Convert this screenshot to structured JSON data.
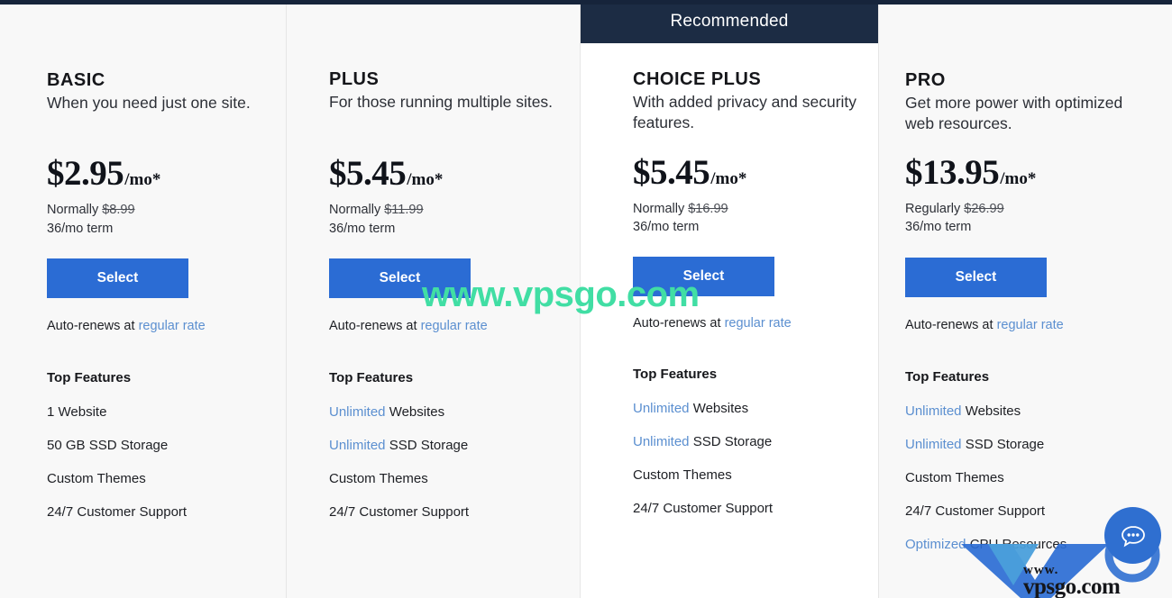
{
  "top_strip_color": "#16243b",
  "accent": {
    "button_blue": "#2b6cd4",
    "link_blue": "#5b8fd0",
    "banner_navy": "#1c2c44",
    "watermark_green": "#41dea4",
    "chat_blue": "#2f6fd0"
  },
  "recommended_banner": {
    "label": "Recommended",
    "applies_to": "CHOICE PLUS"
  },
  "plans": [
    {
      "id": "basic",
      "name": "BASIC",
      "tagline": "When you need just one site.",
      "price": "$2.95",
      "price_suffix": "/mo*",
      "compare_label": "Normally",
      "compare_price": "$8.99",
      "term": "36/mo term",
      "cta": "Select",
      "renew_prefix": "Auto-renews at",
      "renew_link": "regular rate",
      "features_title": "Top Features",
      "features": [
        {
          "highlight": "",
          "text": "1 Website"
        },
        {
          "highlight": "",
          "text": "50 GB SSD Storage"
        },
        {
          "highlight": "",
          "text": "Custom Themes"
        },
        {
          "highlight": "",
          "text": "24/7 Customer Support"
        }
      ]
    },
    {
      "id": "plus",
      "name": "PLUS",
      "tagline": "For those running multiple sites.",
      "price": "$5.45",
      "price_suffix": "/mo*",
      "compare_label": "Normally",
      "compare_price": "$11.99",
      "term": "36/mo term",
      "cta": "Select",
      "renew_prefix": "Auto-renews at",
      "renew_link": "regular rate",
      "features_title": "Top Features",
      "features": [
        {
          "highlight": "Unlimited",
          "text": " Websites"
        },
        {
          "highlight": "Unlimited",
          "text": " SSD Storage"
        },
        {
          "highlight": "",
          "text": "Custom Themes"
        },
        {
          "highlight": "",
          "text": "24/7 Customer Support"
        }
      ]
    },
    {
      "id": "choice-plus",
      "name": "CHOICE PLUS",
      "tagline": "With added privacy and security features.",
      "price": "$5.45",
      "price_suffix": "/mo*",
      "compare_label": "Normally",
      "compare_price": "$16.99",
      "term": "36/mo term",
      "cta": "Select",
      "renew_prefix": "Auto-renews at",
      "renew_link": "regular rate",
      "features_title": "Top Features",
      "features": [
        {
          "highlight": "Unlimited",
          "text": " Websites"
        },
        {
          "highlight": "Unlimited",
          "text": " SSD Storage"
        },
        {
          "highlight": "",
          "text": "Custom Themes"
        },
        {
          "highlight": "",
          "text": "24/7 Customer Support"
        }
      ]
    },
    {
      "id": "pro",
      "name": "PRO",
      "tagline": "Get more power with optimized web resources.",
      "price": "$13.95",
      "price_suffix": "/mo*",
      "compare_label": "Regularly",
      "compare_price": "$26.99",
      "term": "36/mo term",
      "cta": "Select",
      "renew_prefix": "Auto-renews at",
      "renew_link": "regular rate",
      "features_title": "Top Features",
      "features": [
        {
          "highlight": "Unlimited",
          "text": " Websites"
        },
        {
          "highlight": "Unlimited",
          "text": " SSD Storage"
        },
        {
          "highlight": "",
          "text": "Custom Themes"
        },
        {
          "highlight": "",
          "text": "24/7 Customer Support"
        },
        {
          "highlight": "Optimized",
          "text": " CPU Resources"
        }
      ]
    }
  ],
  "watermarks": {
    "banner_text": "www.vpsgo.com",
    "logo_www": "www.",
    "logo_domain": "vpsgo.com"
  },
  "chat_widget": {
    "icon": "chat-bubble-icon",
    "label": "Live chat"
  }
}
